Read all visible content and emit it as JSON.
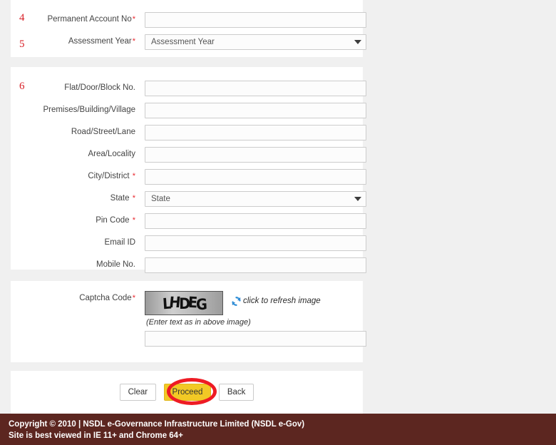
{
  "theme": {
    "page_background": "#f0f0f0",
    "panel_background": "#ffffff",
    "footer_background": "#5c2620",
    "required_marker_color": "#e8262d",
    "annotation_color": "#ee1b24",
    "primary_button_color": "#f2c925"
  },
  "annotations": {
    "step4": "4",
    "step5": "5",
    "step6": "6"
  },
  "identity_section": {
    "fields": [
      {
        "label": "Permanent Account No",
        "required": true,
        "type": "text",
        "value": "",
        "placeholder": ""
      },
      {
        "label": "Assessment Year",
        "required": true,
        "type": "select",
        "selected": "Assessment Year"
      }
    ]
  },
  "address_section": {
    "fields": [
      {
        "label": "Flat/Door/Block No.",
        "required": false,
        "type": "text",
        "value": "",
        "placeholder": ""
      },
      {
        "label": "Premises/Building/Village",
        "required": false,
        "type": "text",
        "value": "",
        "placeholder": ""
      },
      {
        "label": "Road/Street/Lane",
        "required": false,
        "type": "text",
        "value": "",
        "placeholder": ""
      },
      {
        "label": "Area/Locality",
        "required": false,
        "type": "text",
        "value": "",
        "placeholder": ""
      },
      {
        "label": "City/District",
        "required": true,
        "type": "text",
        "value": "",
        "placeholder": ""
      },
      {
        "label": "State",
        "required": true,
        "type": "select",
        "selected": "State"
      },
      {
        "label": "Pin Code",
        "required": true,
        "type": "text",
        "value": "",
        "placeholder": ""
      },
      {
        "label": "Email ID",
        "required": false,
        "type": "text",
        "value": "",
        "placeholder": ""
      },
      {
        "label": "Mobile No.",
        "required": false,
        "type": "text",
        "value": "",
        "placeholder": ""
      }
    ]
  },
  "captcha_section": {
    "label": "Captcha Code",
    "required": true,
    "image_text": "LHDEG",
    "refresh_label": "click to refresh image",
    "refresh_icon": "refresh-icon",
    "hint": "(Enter text as in above image)",
    "input_value": "",
    "input_placeholder": ""
  },
  "actions": {
    "clear_label": "Clear",
    "proceed_label": "Proceed",
    "back_label": "Back"
  },
  "footer": {
    "line1": "Copyright © 2010 | NSDL e-Governance Infrastructure Limited (NSDL e-Gov)",
    "line2": "Site is best viewed in IE 11+ and Chrome 64+"
  }
}
